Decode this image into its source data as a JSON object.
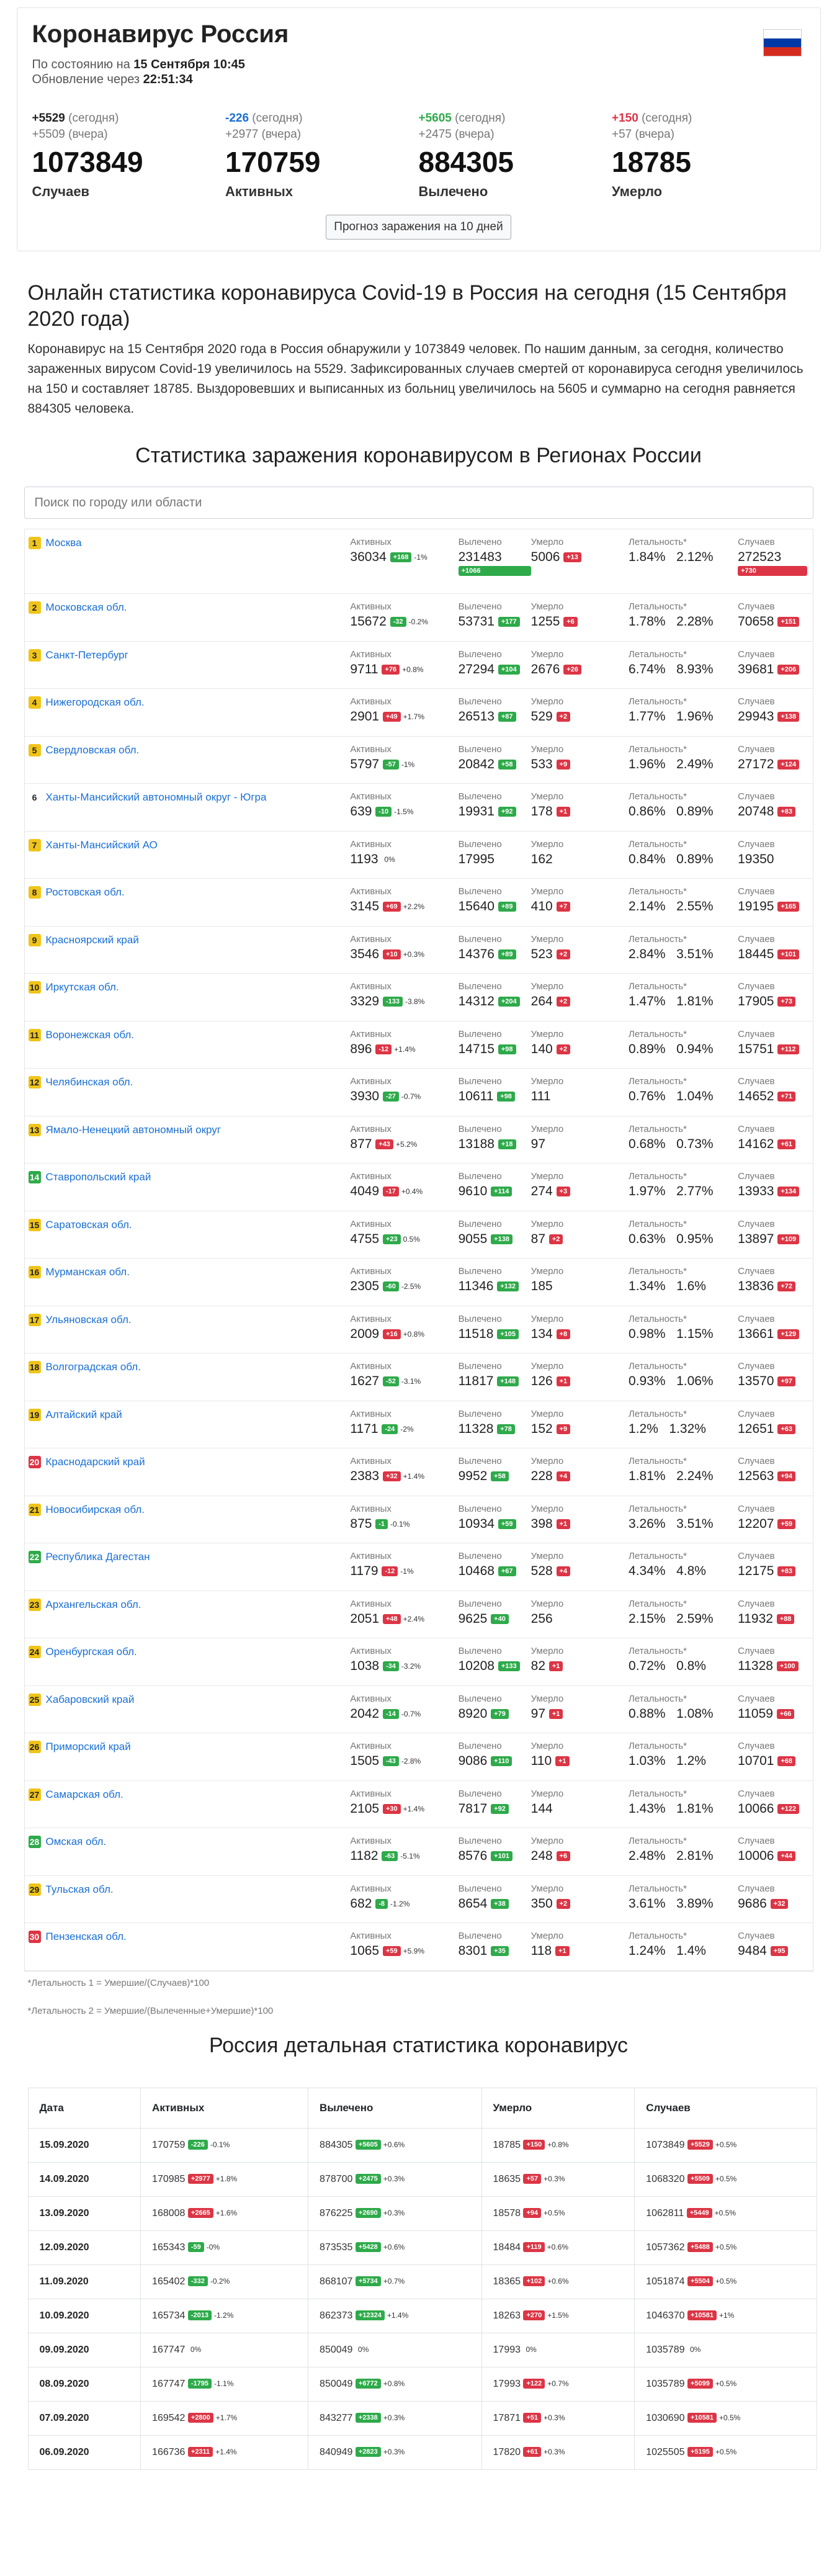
{
  "header": {
    "title": "Коронавирус Россия",
    "status_prefix": "По состоянию на",
    "status_date": "15 Сентября 10:45",
    "update_prefix": "Обновление через",
    "update_timer": "22:51:34"
  },
  "flag_colors": [
    "#ffffff",
    "#0039a6",
    "#d52b1e"
  ],
  "stats": [
    {
      "today": "+5529",
      "today_label": "(сегодня)",
      "yest": "+5509",
      "yest_label": "(вчера)",
      "value": "1073849",
      "label": "Случаев",
      "color": "#222222"
    },
    {
      "today": "-226",
      "today_label": "(сегодня)",
      "yest": "+2977",
      "yest_label": "(вчера)",
      "value": "170759",
      "label": "Активных",
      "color": "#1a6fd4"
    },
    {
      "today": "+5605",
      "today_label": "(сегодня)",
      "yest": "+2475",
      "yest_label": "(вчера)",
      "value": "884305",
      "label": "Вылечено",
      "color": "#2eaa4a"
    },
    {
      "today": "+150",
      "today_label": "(сегодня)",
      "yest": "+57",
      "yest_label": "(вчера)",
      "value": "18785",
      "label": "Умерло",
      "color": "#dc3545"
    }
  ],
  "forecast_button": "Прогноз заражения на 10 дней",
  "online_title": "Онлайн статистика коронавируса Covid-19 в Россия на сегодня (15 Сентября 2020 года)",
  "online_desc": "Коронавирус на 15 Сентября 2020 года в Россия обнаружили у 1073849 человек. По нашим данным, за сегодня, количество зараженных вирусом Covid-19 увеличилось на 5529. Зафиксированных случаев смертей от коронавируса сегодня увеличилось на 150 и составляет 18785. Выздоровевших и выписанных из больниц увеличилось на 5605 и суммарно на сегодня равняется 884305 человека.",
  "regions_title": "Статистика заражения коронавирусом в Регионах России",
  "search_placeholder": "Поиск по городу или области",
  "col_headers": {
    "active": "Активных",
    "recovered": "Вылечено",
    "died": "Умерло",
    "lethality": "Летальность*",
    "cases": "Случаев"
  },
  "regions": [
    {
      "rank": "1",
      "rc": "y",
      "name": "Москва",
      "active": "36034",
      "ab": "+168",
      "abc": "g",
      "ap": "-1%",
      "rec": "231483",
      "rb": "+1066",
      "died": "5006",
      "db": "+13",
      "l1": "1.84%",
      "l2": "2.12%",
      "cases": "272523",
      "cb": "+730",
      "stack": true
    },
    {
      "rank": "2",
      "rc": "y",
      "name": "Московская обл.",
      "active": "15672",
      "ab": "-32",
      "abc": "g",
      "ap": "-0.2%",
      "rec": "53731",
      "rb": "+177",
      "died": "1255",
      "db": "+6",
      "l1": "1.78%",
      "l2": "2.28%",
      "cases": "70658",
      "cb": "+151"
    },
    {
      "rank": "3",
      "rc": "y",
      "name": "Санкт-Петербург",
      "active": "9711",
      "ab": "+76",
      "abc": "r",
      "ap": "+0.8%",
      "rec": "27294",
      "rb": "+104",
      "died": "2676",
      "db": "+26",
      "l1": "6.74%",
      "l2": "8.93%",
      "cases": "39681",
      "cb": "+206"
    },
    {
      "rank": "4",
      "rc": "y",
      "name": "Нижегородская обл.",
      "active": "2901",
      "ab": "+49",
      "abc": "r",
      "ap": "+1.7%",
      "rec": "26513",
      "rb": "+87",
      "died": "529",
      "db": "+2",
      "l1": "1.77%",
      "l2": "1.96%",
      "cases": "29943",
      "cb": "+138"
    },
    {
      "rank": "5",
      "rc": "y",
      "name": "Свердловская обл.",
      "active": "5797",
      "ab": "-57",
      "abc": "g",
      "ap": "-1%",
      "rec": "20842",
      "rb": "+58",
      "died": "533",
      "db": "+9",
      "l1": "1.96%",
      "l2": "2.49%",
      "cases": "27172",
      "cb": "+124"
    },
    {
      "rank": "6",
      "rc": "n",
      "name": "Ханты-Мансийский автономный округ - Югра",
      "active": "639",
      "ab": "-10",
      "abc": "g",
      "ap": "-1.5%",
      "rec": "19931",
      "rb": "+92",
      "died": "178",
      "db": "+1",
      "l1": "0.86%",
      "l2": "0.89%",
      "cases": "20748",
      "cb": "+83"
    },
    {
      "rank": "7",
      "rc": "y",
      "name": "Ханты-Мансийский АО",
      "active": "1193",
      "ab": "",
      "abc": "g",
      "ap": "0%",
      "rec": "17995",
      "rb": "",
      "died": "162",
      "db": "",
      "l1": "0.84%",
      "l2": "0.89%",
      "cases": "19350",
      "cb": ""
    },
    {
      "rank": "8",
      "rc": "y",
      "name": "Ростовская обл.",
      "active": "3145",
      "ab": "+69",
      "abc": "r",
      "ap": "+2.2%",
      "rec": "15640",
      "rb": "+89",
      "died": "410",
      "db": "+7",
      "l1": "2.14%",
      "l2": "2.55%",
      "cases": "19195",
      "cb": "+165"
    },
    {
      "rank": "9",
      "rc": "y",
      "name": "Красноярский край",
      "active": "3546",
      "ab": "+10",
      "abc": "r",
      "ap": "+0.3%",
      "rec": "14376",
      "rb": "+89",
      "died": "523",
      "db": "+2",
      "l1": "2.84%",
      "l2": "3.51%",
      "cases": "18445",
      "cb": "+101"
    },
    {
      "rank": "10",
      "rc": "y",
      "name": "Иркутская обл.",
      "active": "3329",
      "ab": "-133",
      "abc": "g",
      "ap": "-3.8%",
      "rec": "14312",
      "rb": "+204",
      "died": "264",
      "db": "+2",
      "l1": "1.47%",
      "l2": "1.81%",
      "cases": "17905",
      "cb": "+73"
    },
    {
      "rank": "11",
      "rc": "y",
      "name": "Воронежская обл.",
      "active": "896",
      "ab": "-12",
      "abc": "r",
      "ap": "+1.4%",
      "rec": "14715",
      "rb": "+98",
      "died": "140",
      "db": "+2",
      "l1": "0.89%",
      "l2": "0.94%",
      "cases": "15751",
      "cb": "+112"
    },
    {
      "rank": "12",
      "rc": "y",
      "name": "Челябинская обл.",
      "active": "3930",
      "ab": "-27",
      "abc": "g",
      "ap": "-0.7%",
      "rec": "10611",
      "rb": "+98",
      "died": "111",
      "db": "",
      "l1": "0.76%",
      "l2": "1.04%",
      "cases": "14652",
      "cb": "+71"
    },
    {
      "rank": "13",
      "rc": "y",
      "name": "Ямало-Ненецкий автономный округ",
      "active": "877",
      "ab": "+43",
      "abc": "r",
      "ap": "+5.2%",
      "rec": "13188",
      "rb": "+18",
      "died": "97",
      "db": "",
      "l1": "0.68%",
      "l2": "0.73%",
      "cases": "14162",
      "cb": "+61"
    },
    {
      "rank": "14",
      "rc": "g",
      "name": "Ставропольский край",
      "active": "4049",
      "ab": "-17",
      "abc": "r",
      "ap": "+0.4%",
      "rec": "9610",
      "rb": "+114",
      "died": "274",
      "db": "+3",
      "l1": "1.97%",
      "l2": "2.77%",
      "cases": "13933",
      "cb": "+134"
    },
    {
      "rank": "15",
      "rc": "y",
      "name": "Саратовская обл.",
      "active": "4755",
      "ab": "+23",
      "abc": "g",
      "ap": "0.5%",
      "rec": "9055",
      "rb": "+138",
      "died": "87",
      "db": "+2",
      "l1": "0.63%",
      "l2": "0.95%",
      "cases": "13897",
      "cb": "+109"
    },
    {
      "rank": "16",
      "rc": "y",
      "name": "Мурманская обл.",
      "active": "2305",
      "ab": "-60",
      "abc": "g",
      "ap": "-2.5%",
      "rec": "11346",
      "rb": "+132",
      "died": "185",
      "db": "",
      "l1": "1.34%",
      "l2": "1.6%",
      "cases": "13836",
      "cb": "+72"
    },
    {
      "rank": "17",
      "rc": "y",
      "name": "Ульяновская обл.",
      "active": "2009",
      "ab": "+16",
      "abc": "r",
      "ap": "+0.8%",
      "rec": "11518",
      "rb": "+105",
      "died": "134",
      "db": "+8",
      "l1": "0.98%",
      "l2": "1.15%",
      "cases": "13661",
      "cb": "+129"
    },
    {
      "rank": "18",
      "rc": "y",
      "name": "Волгоградская обл.",
      "active": "1627",
      "ab": "-52",
      "abc": "g",
      "ap": "-3.1%",
      "rec": "11817",
      "rb": "+148",
      "died": "126",
      "db": "+1",
      "l1": "0.93%",
      "l2": "1.06%",
      "cases": "13570",
      "cb": "+97"
    },
    {
      "rank": "19",
      "rc": "y",
      "name": "Алтайский край",
      "active": "1171",
      "ab": "-24",
      "abc": "g",
      "ap": "-2%",
      "rec": "11328",
      "rb": "+78",
      "died": "152",
      "db": "+9",
      "l1": "1.2%",
      "l2": "1.32%",
      "cases": "12651",
      "cb": "+63"
    },
    {
      "rank": "20",
      "rc": "r",
      "name": "Краснодарский край",
      "active": "2383",
      "ab": "+32",
      "abc": "r",
      "ap": "+1.4%",
      "rec": "9952",
      "rb": "+58",
      "died": "228",
      "db": "+4",
      "l1": "1.81%",
      "l2": "2.24%",
      "cases": "12563",
      "cb": "+94"
    },
    {
      "rank": "21",
      "rc": "y",
      "name": "Новосибирская обл.",
      "active": "875",
      "ab": "-1",
      "abc": "g",
      "ap": "-0.1%",
      "rec": "10934",
      "rb": "+59",
      "died": "398",
      "db": "+1",
      "l1": "3.26%",
      "l2": "3.51%",
      "cases": "12207",
      "cb": "+59"
    },
    {
      "rank": "22",
      "rc": "g",
      "name": "Республика Дагестан",
      "active": "1179",
      "ab": "-12",
      "abc": "r",
      "ap": "-1%",
      "rec": "10468",
      "rb": "+67",
      "died": "528",
      "db": "+4",
      "l1": "4.34%",
      "l2": "4.8%",
      "cases": "12175",
      "cb": "+83"
    },
    {
      "rank": "23",
      "rc": "y",
      "name": "Архангельская обл.",
      "active": "2051",
      "ab": "+48",
      "abc": "r",
      "ap": "+2.4%",
      "rec": "9625",
      "rb": "+40",
      "died": "256",
      "db": "",
      "l1": "2.15%",
      "l2": "2.59%",
      "cases": "11932",
      "cb": "+88"
    },
    {
      "rank": "24",
      "rc": "y",
      "name": "Оренбургская обл.",
      "active": "1038",
      "ab": "-34",
      "abc": "g",
      "ap": "-3.2%",
      "rec": "10208",
      "rb": "+133",
      "died": "82",
      "db": "+1",
      "l1": "0.72%",
      "l2": "0.8%",
      "cases": "11328",
      "cb": "+100"
    },
    {
      "rank": "25",
      "rc": "y",
      "name": "Хабаровский край",
      "active": "2042",
      "ab": "-14",
      "abc": "g",
      "ap": "-0.7%",
      "rec": "8920",
      "rb": "+79",
      "died": "97",
      "db": "+1",
      "l1": "0.88%",
      "l2": "1.08%",
      "cases": "11059",
      "cb": "+66"
    },
    {
      "rank": "26",
      "rc": "y",
      "name": "Приморский край",
      "active": "1505",
      "ab": "-43",
      "abc": "g",
      "ap": "-2.8%",
      "rec": "9086",
      "rb": "+110",
      "died": "110",
      "db": "+1",
      "l1": "1.03%",
      "l2": "1.2%",
      "cases": "10701",
      "cb": "+68"
    },
    {
      "rank": "27",
      "rc": "y",
      "name": "Самарская обл.",
      "active": "2105",
      "ab": "+30",
      "abc": "r",
      "ap": "+1.4%",
      "rec": "7817",
      "rb": "+92",
      "died": "144",
      "db": "",
      "l1": "1.43%",
      "l2": "1.81%",
      "cases": "10066",
      "cb": "+122"
    },
    {
      "rank": "28",
      "rc": "g",
      "name": "Омская обл.",
      "active": "1182",
      "ab": "-63",
      "abc": "g",
      "ap": "-5.1%",
      "rec": "8576",
      "rb": "+101",
      "died": "248",
      "db": "+6",
      "l1": "2.48%",
      "l2": "2.81%",
      "cases": "10006",
      "cb": "+44"
    },
    {
      "rank": "29",
      "rc": "y",
      "name": "Тульская обл.",
      "active": "682",
      "ab": "-8",
      "abc": "g",
      "ap": "-1.2%",
      "rec": "8654",
      "rb": "+38",
      "died": "350",
      "db": "+2",
      "l1": "3.61%",
      "l2": "3.89%",
      "cases": "9686",
      "cb": "+32"
    },
    {
      "rank": "30",
      "rc": "r",
      "name": "Пензенская обл.",
      "active": "1065",
      "ab": "+59",
      "abc": "r",
      "ap": "+5.9%",
      "rec": "8301",
      "rb": "+35",
      "died": "118",
      "db": "+1",
      "l1": "1.24%",
      "l2": "1.4%",
      "cases": "9484",
      "cb": "+95"
    }
  ],
  "notes": [
    "*Летальность 1 = Умершие/(Случаев)*100",
    "*Летальность 2 = Умершие/(Вылеченные+Умершие)*100"
  ],
  "detail_title": "Россия детальная статистика коронавирус",
  "daily_headers": [
    "Дата",
    "Активных",
    "Вылечено",
    "Умерло",
    "Случаев"
  ],
  "daily": [
    {
      "date": "15.09.2020",
      "a": "170759",
      "ab": "-226",
      "abc": "g",
      "ap": "-0.1%",
      "r": "884305",
      "rb": "+5605",
      "rp": "+0.6%",
      "d": "18785",
      "db": "+150",
      "dp": "+0.8%",
      "c": "1073849",
      "cb": "+5529",
      "cp": "+0.5%"
    },
    {
      "date": "14.09.2020",
      "a": "170985",
      "ab": "+2977",
      "abc": "r",
      "ap": "+1.8%",
      "r": "878700",
      "rb": "+2475",
      "rp": "+0.3%",
      "d": "18635",
      "db": "+57",
      "dp": "+0.3%",
      "c": "1068320",
      "cb": "+5509",
      "cp": "+0.5%"
    },
    {
      "date": "13.09.2020",
      "a": "168008",
      "ab": "+2665",
      "abc": "r",
      "ap": "+1.6%",
      "r": "876225",
      "rb": "+2690",
      "rp": "+0.3%",
      "d": "18578",
      "db": "+94",
      "dp": "+0.5%",
      "c": "1062811",
      "cb": "+5449",
      "cp": "+0.5%"
    },
    {
      "date": "12.09.2020",
      "a": "165343",
      "ab": "-59",
      "abc": "g",
      "ap": "-0%",
      "r": "873535",
      "rb": "+5428",
      "rp": "+0.6%",
      "d": "18484",
      "db": "+119",
      "dp": "+0.6%",
      "c": "1057362",
      "cb": "+5488",
      "cp": "+0.5%"
    },
    {
      "date": "11.09.2020",
      "a": "165402",
      "ab": "-332",
      "abc": "g",
      "ap": "-0.2%",
      "r": "868107",
      "rb": "+5734",
      "rp": "+0.7%",
      "d": "18365",
      "db": "+102",
      "dp": "+0.6%",
      "c": "1051874",
      "cb": "+5504",
      "cp": "+0.5%"
    },
    {
      "date": "10.09.2020",
      "a": "165734",
      "ab": "-2013",
      "abc": "g",
      "ap": "-1.2%",
      "r": "862373",
      "rb": "+12324",
      "rp": "+1.4%",
      "d": "18263",
      "db": "+270",
      "dp": "+1.5%",
      "c": "1046370",
      "cb": "+10581",
      "cp": "+1%"
    },
    {
      "date": "09.09.2020",
      "a": "167747",
      "ab": "",
      "abc": "g",
      "ap": "0%",
      "r": "850049",
      "rb": "",
      "rp": "0%",
      "d": "17993",
      "db": "",
      "dp": "0%",
      "c": "1035789",
      "cb": "",
      "cp": "0%"
    },
    {
      "date": "08.09.2020",
      "a": "167747",
      "ab": "-1795",
      "abc": "g",
      "ap": "-1.1%",
      "r": "850049",
      "rb": "+6772",
      "rp": "+0.8%",
      "d": "17993",
      "db": "+122",
      "dp": "+0.7%",
      "c": "1035789",
      "cb": "+5099",
      "cp": "+0.5%"
    },
    {
      "date": "07.09.2020",
      "a": "169542",
      "ab": "+2800",
      "abc": "r",
      "ap": "+1.7%",
      "r": "843277",
      "rb": "+2338",
      "rp": "+0.3%",
      "d": "17871",
      "db": "+51",
      "dp": "+0.3%",
      "c": "1030690",
      "cb": "+10581",
      "cp": "+0.5%"
    },
    {
      "date": "06.09.2020",
      "a": "166736",
      "ab": "+2311",
      "abc": "r",
      "ap": "+1.4%",
      "r": "840949",
      "rb": "+2823",
      "rp": "+0.3%",
      "d": "17820",
      "db": "+61",
      "dp": "+0.3%",
      "c": "1025505",
      "cb": "+5195",
      "cp": "+0.5%"
    }
  ]
}
